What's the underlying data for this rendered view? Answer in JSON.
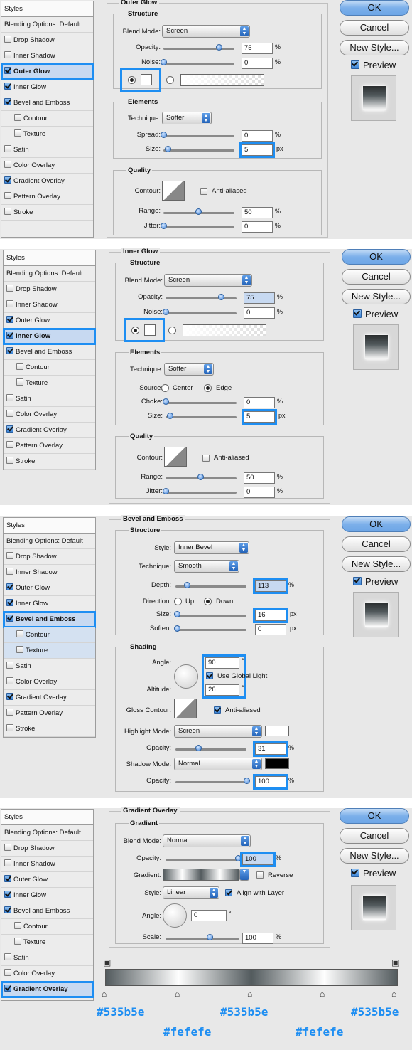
{
  "dialog": {
    "ok": "OK",
    "cancel": "Cancel",
    "new_style": "New Style...",
    "preview": "Preview"
  },
  "styles_list": {
    "header": "Styles",
    "blending": "Blending Options: Default",
    "drop_shadow": "Drop Shadow",
    "inner_shadow": "Inner Shadow",
    "outer_glow": "Outer Glow",
    "inner_glow": "Inner Glow",
    "bevel": "Bevel and Emboss",
    "contour": "Contour",
    "texture": "Texture",
    "satin": "Satin",
    "color_overlay": "Color Overlay",
    "gradient_overlay": "Gradient Overlay",
    "pattern_overlay": "Pattern Overlay",
    "stroke": "Stroke"
  },
  "outer_glow": {
    "title": "Outer Glow",
    "structure": "Structure",
    "blend_mode_label": "Blend Mode:",
    "blend_mode": "Screen",
    "opacity_label": "Opacity:",
    "opacity": "75",
    "noise_label": "Noise:",
    "noise": "0",
    "elements": "Elements",
    "technique_label": "Technique:",
    "technique": "Softer",
    "spread_label": "Spread:",
    "spread": "0",
    "size_label": "Size:",
    "size": "5",
    "quality": "Quality",
    "contour_label": "Contour:",
    "anti_aliased": "Anti-aliased",
    "range_label": "Range:",
    "range": "50",
    "jitter_label": "Jitter:",
    "jitter": "0",
    "pct": "%",
    "px": "px"
  },
  "inner_glow": {
    "title": "Inner Glow",
    "structure": "Structure",
    "blend_mode_label": "Blend Mode:",
    "blend_mode": "Screen",
    "opacity_label": "Opacity:",
    "opacity": "75",
    "noise_label": "Noise:",
    "noise": "0",
    "elements": "Elements",
    "technique_label": "Technique:",
    "technique": "Softer",
    "source_label": "Source:",
    "center": "Center",
    "edge": "Edge",
    "choke_label": "Choke:",
    "choke": "0",
    "size_label": "Size:",
    "size": "5",
    "quality": "Quality",
    "contour_label": "Contour:",
    "anti_aliased": "Anti-aliased",
    "range_label": "Range:",
    "range": "50",
    "jitter_label": "Jitter:",
    "jitter": "0",
    "pct": "%",
    "px": "px"
  },
  "bevel": {
    "title": "Bevel and Emboss",
    "structure": "Structure",
    "style_label": "Style:",
    "style": "Inner Bevel",
    "technique_label": "Technique:",
    "technique": "Smooth",
    "depth_label": "Depth:",
    "depth": "113",
    "direction_label": "Direction:",
    "up": "Up",
    "down": "Down",
    "size_label": "Size:",
    "size": "16",
    "soften_label": "Soften:",
    "soften": "0",
    "shading": "Shading",
    "angle_label": "Angle:",
    "angle": "90",
    "deg": "°",
    "global_light": "Use Global Light",
    "altitude_label": "Altitude:",
    "altitude": "26",
    "gloss_label": "Gloss Contour:",
    "anti_aliased": "Anti-aliased",
    "highlight_mode_label": "Highlight Mode:",
    "highlight_mode": "Screen",
    "hl_opacity_label": "Opacity:",
    "hl_opacity": "31",
    "shadow_mode_label": "Shadow Mode:",
    "shadow_mode": "Normal",
    "sh_opacity_label": "Opacity:",
    "sh_opacity": "100",
    "pct": "%",
    "px": "px"
  },
  "gradient_overlay": {
    "title": "Gradient Overlay",
    "gradient_group": "Gradient",
    "blend_mode_label": "Blend Mode:",
    "blend_mode": "Normal",
    "opacity_label": "Opacity:",
    "opacity": "100",
    "gradient_label": "Gradient:",
    "reverse": "Reverse",
    "style_label": "Style:",
    "style": "Linear",
    "align": "Align with Layer",
    "angle_label": "Angle:",
    "angle": "0",
    "deg": "°",
    "scale_label": "Scale:",
    "scale": "100",
    "pct": "%"
  },
  "gradient_stops": {
    "c1": "#535b5e",
    "c2": "#fefefe",
    "c3": "#535b5e",
    "c4": "#fefefe",
    "c5": "#535b5e"
  },
  "colors": {
    "accent": "#1e8ef2",
    "dark": "#535b5e",
    "light": "#fefefe"
  }
}
